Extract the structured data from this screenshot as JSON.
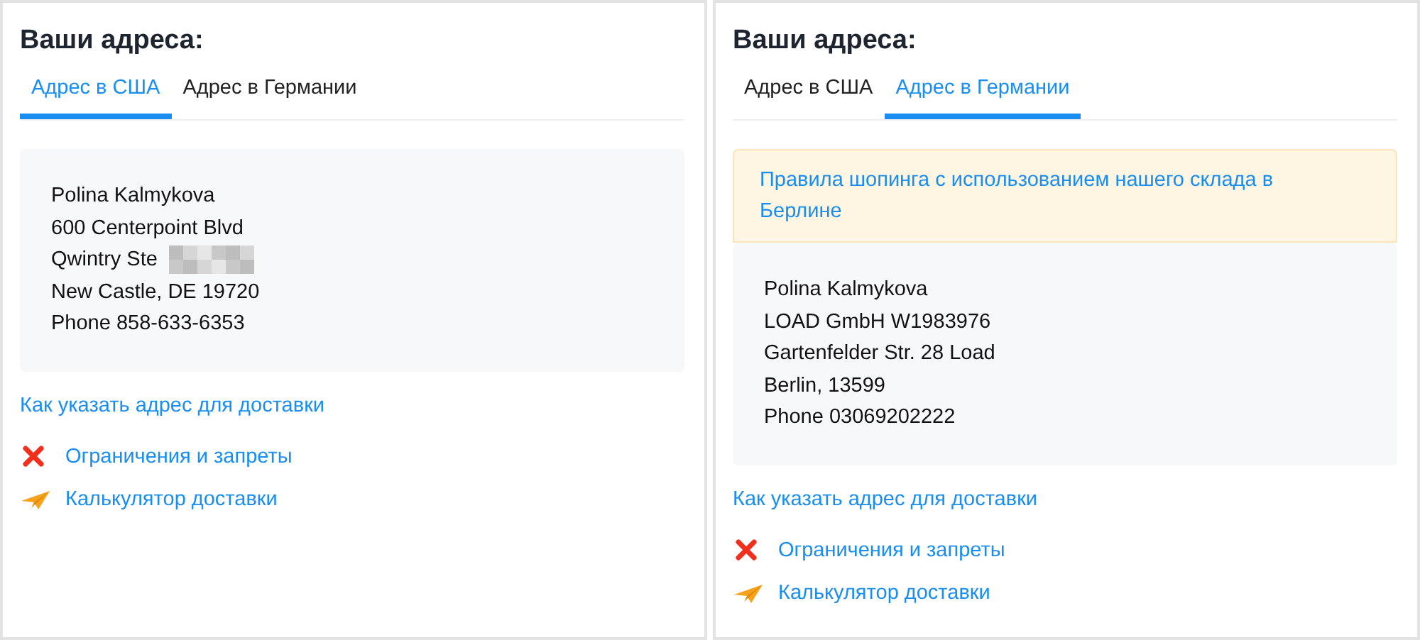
{
  "panels": [
    {
      "title": "Ваши адреса:",
      "tabs": [
        {
          "label": "Адрес в США",
          "selected": true
        },
        {
          "label": "Адрес в Германии",
          "selected": false
        }
      ],
      "address": [
        {
          "text": "Polina Kalmykova"
        },
        {
          "text": "600 Centerpoint Blvd"
        },
        {
          "text": "Qwintry Ste",
          "redacted": true
        },
        {
          "text": "New Castle, DE 19720"
        },
        {
          "text": "Phone 858-633-6353"
        }
      ],
      "help_link": "Как указать адрес для доставки",
      "links": [
        {
          "kind": "restrictions",
          "label": "Ограничения и запреты"
        },
        {
          "kind": "calculator",
          "label": "Калькулятор доставки"
        }
      ]
    },
    {
      "title": "Ваши адреса:",
      "tabs": [
        {
          "label": "Адрес в США",
          "selected": false
        },
        {
          "label": "Адрес в Германии",
          "selected": true
        }
      ],
      "notice": "Правила шопинга с использованием нашего склада в Берлине",
      "address": [
        {
          "text": "Polina Kalmykova"
        },
        {
          "text": "LOAD GmbH W1983976"
        },
        {
          "text": "Gartenfelder Str. 28 Load"
        },
        {
          "text": "Berlin, 13599"
        },
        {
          "text": "Phone 03069202222"
        }
      ],
      "help_link": "Как указать адрес для доставки",
      "links": [
        {
          "kind": "restrictions",
          "label": "Ограничения и запреты"
        },
        {
          "kind": "calculator",
          "label": "Калькулятор доставки"
        }
      ]
    }
  ]
}
